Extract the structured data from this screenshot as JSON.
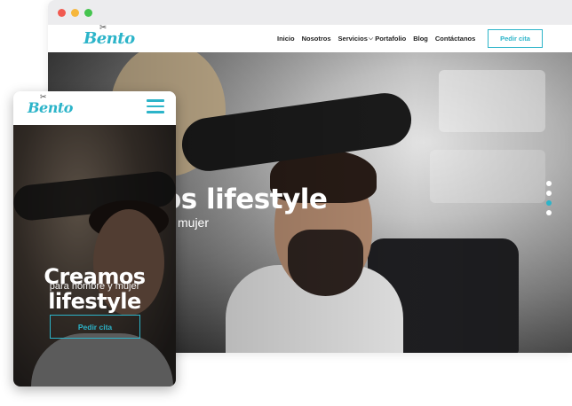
{
  "colors": {
    "accent": "#2cb4c9",
    "traffic_close": "#f15a50",
    "traffic_minimize": "#f6b73c",
    "traffic_maximize": "#45c44f"
  },
  "brand": {
    "logo_text": "Bento",
    "logo_icon": "scissors-icon"
  },
  "desktop": {
    "nav": {
      "items": [
        "Inicio",
        "Nosotros",
        "Servicios",
        "Portafolio",
        "Blog",
        "Contáctanos"
      ],
      "dropdown_icon": "chevron-down-icon"
    },
    "cta_label": "Pedir cita",
    "hero": {
      "title_visible": "os lifestyle",
      "subtitle_visible": "mujer"
    },
    "slider": {
      "count": 4,
      "active_index": 2
    }
  },
  "mobile": {
    "menu_icon": "hamburger-icon",
    "hero": {
      "title_line1": "Creamos",
      "title_line2": "lifestyle",
      "subtitle": "para hombre y mujer"
    },
    "cta_label": "Pedir cita"
  }
}
